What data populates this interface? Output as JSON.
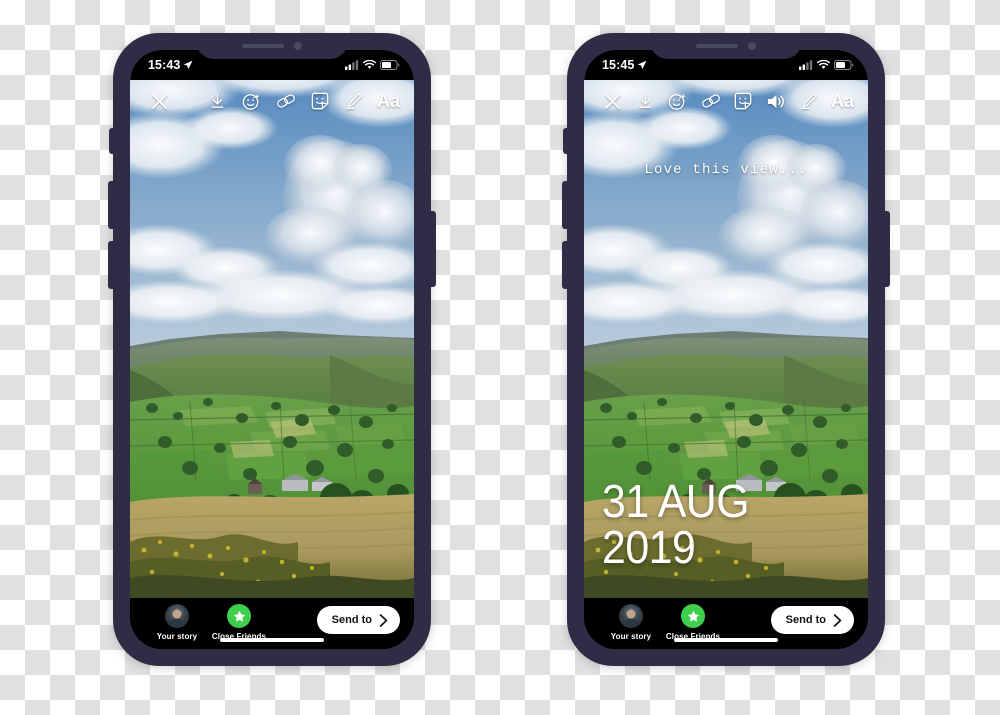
{
  "scene": {
    "description": "Two iPhone mockups side by side showing an Instagram story editor with a countryside landscape photo",
    "frame_color": "#2e2d45",
    "background": "transparency-checkerboard"
  },
  "phones": [
    {
      "id": "phone-left",
      "status_bar": {
        "time": "15:43",
        "location_icon": "location-arrow-icon",
        "signal_icon": "cellular-signal-icon",
        "wifi_icon": "wifi-icon",
        "battery_icon": "battery-icon"
      },
      "toolbar": {
        "close_label": "close-icon",
        "items": [
          {
            "name": "save-icon",
            "label": "Save"
          },
          {
            "name": "effects-icon",
            "label": "Effects"
          },
          {
            "name": "link-icon",
            "label": "Link"
          },
          {
            "name": "sticker-icon",
            "label": "Sticker"
          },
          {
            "name": "draw-icon",
            "label": "Draw"
          }
        ],
        "text_tool_label": "Aa"
      },
      "overlays": {
        "caption": "",
        "date": ""
      },
      "bottom_bar": {
        "your_story_label": "Your story",
        "close_friends_label": "Close Friends",
        "send_to_label": "Send to",
        "send_to_chevron": "chevron-right-icon",
        "close_friends_color": "#3ecf4c"
      }
    },
    {
      "id": "phone-right",
      "status_bar": {
        "time": "15:45",
        "location_icon": "location-arrow-icon",
        "signal_icon": "cellular-signal-icon",
        "wifi_icon": "wifi-icon",
        "battery_icon": "battery-icon"
      },
      "toolbar": {
        "close_label": "close-icon",
        "items": [
          {
            "name": "save-icon",
            "label": "Save"
          },
          {
            "name": "effects-icon",
            "label": "Effects"
          },
          {
            "name": "link-icon",
            "label": "Link"
          },
          {
            "name": "sticker-icon",
            "label": "Sticker"
          },
          {
            "name": "volume-icon",
            "label": "Sound"
          },
          {
            "name": "draw-icon",
            "label": "Draw"
          }
        ],
        "text_tool_label": "Aa"
      },
      "overlays": {
        "caption": "Love this view...",
        "date": "31 AUG 2019"
      },
      "bottom_bar": {
        "your_story_label": "Your story",
        "close_friends_label": "Close Friends",
        "send_to_label": "Send to",
        "send_to_chevron": "chevron-right-icon",
        "close_friends_color": "#3ecf4c"
      }
    }
  ]
}
